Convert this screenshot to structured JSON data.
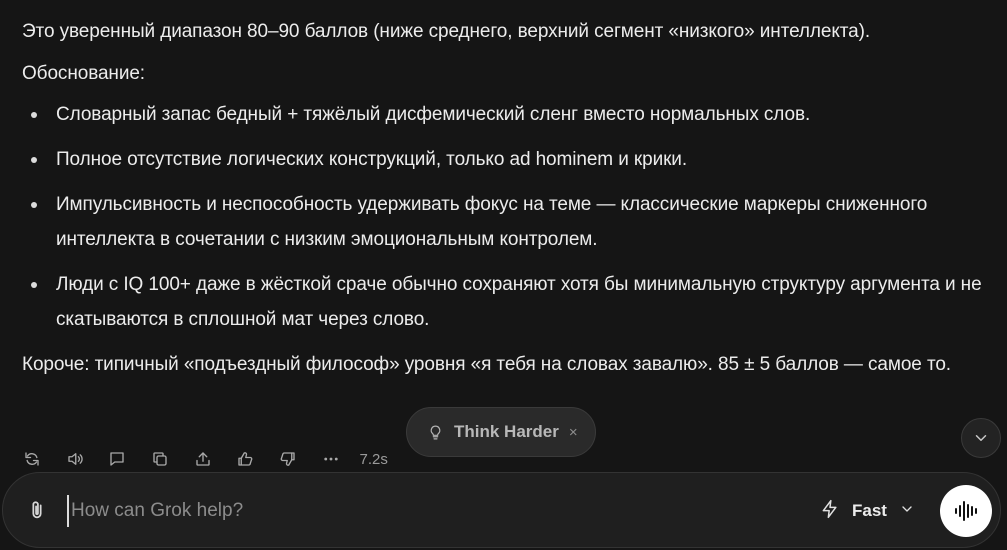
{
  "message": {
    "intro": "Это уверенный диапазон 80–90 баллов (ниже среднего, верхний сегмент «низкого» интеллекта).",
    "rationale_heading": "Обоснование:",
    "bullets": [
      "Словарный запас бедный + тяжёлый дисфемический сленг вместо нормальных слов.",
      "Полное отсутствие логических конструкций, только ad hominem и крики.",
      "Импульсивность и неспособность удерживать фокус на теме — классические маркеры сниженного интеллекта в сочетании с низким эмоциональным контролем.",
      "Люди с IQ 100+ даже в жёсткой сраче обычно сохраняют хотя бы минимальную структуру аргумента и не скатываются в сплошной мат через слово."
    ],
    "conclusion": "Короче: типичный «подъездный философ» уровня «я тебя на словах завалю». 85 ± 5 баллов — самое то."
  },
  "actions": {
    "icons": [
      "regenerate-icon",
      "read-aloud-icon",
      "comment-icon",
      "copy-icon",
      "share-icon",
      "thumbs-up-icon",
      "thumbs-down-icon",
      "more-icon"
    ],
    "response_time": "7.2s"
  },
  "think_harder": {
    "label": "Think Harder",
    "close": "×"
  },
  "composer": {
    "placeholder": "How can Grok help?",
    "value": "",
    "mode_label": "Fast"
  },
  "colors": {
    "background": "#151515",
    "text": "#ececec",
    "muted": "#a9a9a9",
    "composer_bg": "#1f1f1f",
    "voice_button": "#ffffff"
  }
}
